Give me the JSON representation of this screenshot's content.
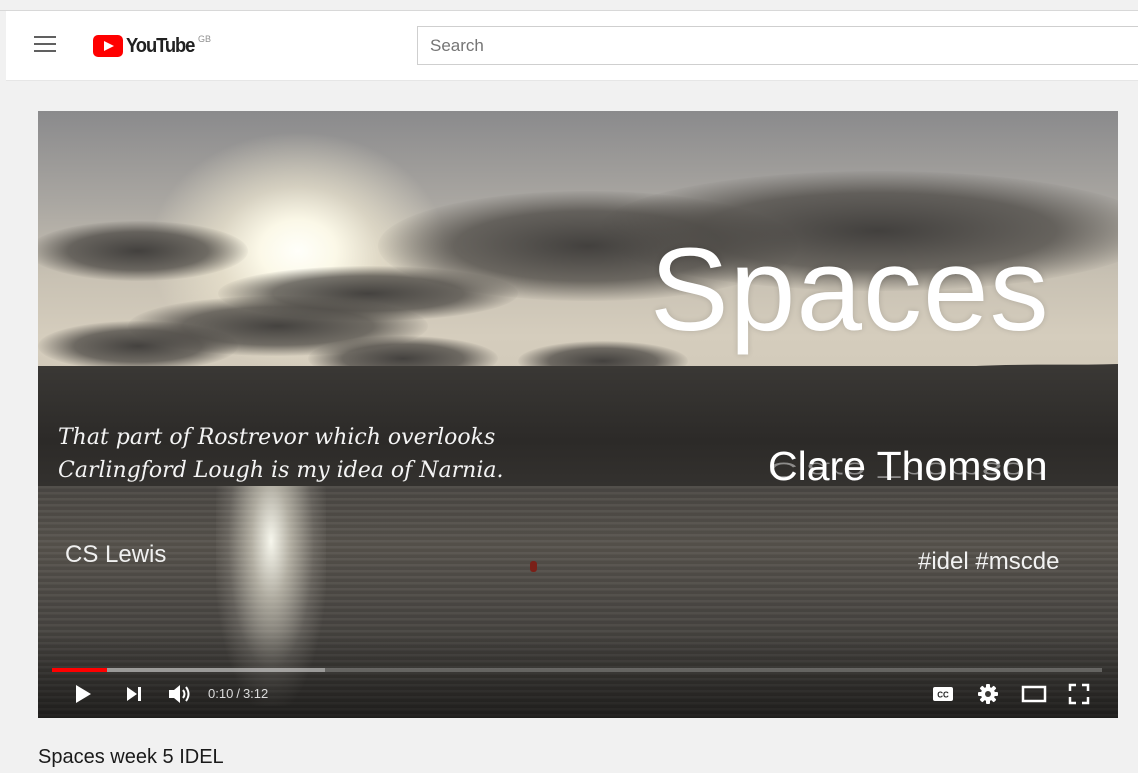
{
  "header": {
    "menu_icon": "hamburger-menu-icon",
    "logo_text": "YouTube",
    "region": "GB",
    "search_placeholder": "Search"
  },
  "video": {
    "title_overlay": "Spaces",
    "author_overlay": "Clare Thomson",
    "quote_line1": "That part of Rostrevor which overlooks",
    "quote_line2": "Carlingford Lough is my idea of Narnia.",
    "quote_author": "CS Lewis",
    "hashtags": "#idel #mscde"
  },
  "player": {
    "current_time": "0:10",
    "duration": "3:12",
    "played_fraction": 0.052,
    "buffered_fraction": 0.26,
    "icons": [
      "play-icon",
      "next-icon",
      "volume-icon",
      "captions-icon",
      "settings-icon",
      "theater-mode-icon",
      "fullscreen-icon"
    ]
  },
  "below": {
    "video_title": "Spaces week 5 IDEL"
  },
  "colors": {
    "brand_red": "#ff0000",
    "background": "#f1f1f1"
  }
}
